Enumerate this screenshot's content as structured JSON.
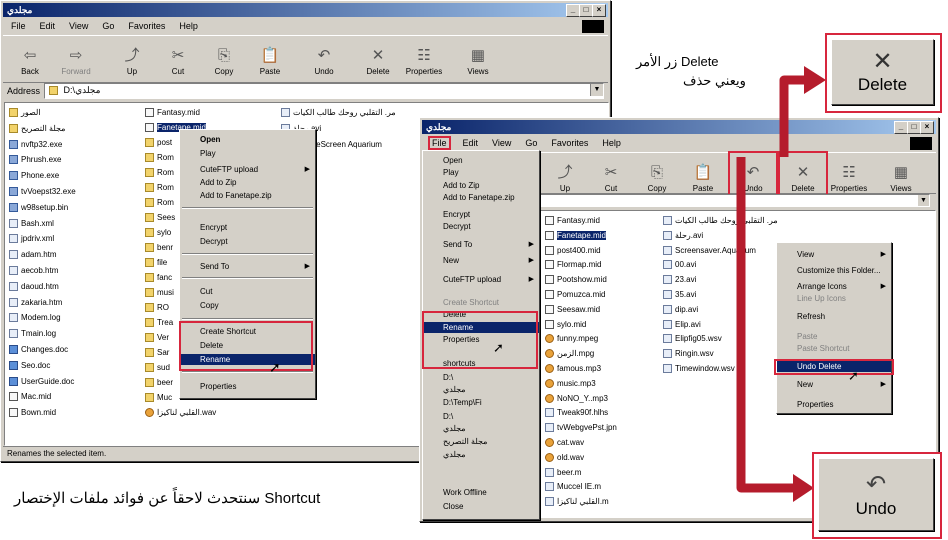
{
  "left_window": {
    "title": "مجلدي",
    "menu": [
      "File",
      "Edit",
      "View",
      "Go",
      "Favorites",
      "Help"
    ],
    "toolbar": [
      {
        "label": "Back",
        "icon": "back-arrow-icon"
      },
      {
        "label": "Forward",
        "icon": "forward-arrow-icon"
      },
      {
        "label": "Up",
        "icon": "up-folder-icon"
      },
      {
        "label": "Cut",
        "icon": "scissors-icon"
      },
      {
        "label": "Copy",
        "icon": "copy-icon"
      },
      {
        "label": "Paste",
        "icon": "paste-icon"
      },
      {
        "label": "Undo",
        "icon": "undo-icon"
      },
      {
        "label": "Delete",
        "icon": "delete-x-icon"
      },
      {
        "label": "Properties",
        "icon": "properties-icon"
      },
      {
        "label": "Views",
        "icon": "views-icon"
      }
    ],
    "address_label": "Address",
    "address_value": "D:\\مجلدي",
    "files_col1": [
      "الصور",
      "مجلة التصريح",
      "nvftp32.exe",
      "Phrush.exe",
      "Phone.exe",
      "tvVoepst32.exe",
      "w98setup.bin",
      "Bash.xml",
      "jpdriv.xml",
      "adam.htm",
      "aecob.htm",
      "daoud.htm",
      "zakaria.htm",
      "Modem.log",
      "Tmain.log",
      "Changes.doc",
      "Seo.doc",
      "UserGuide.doc",
      "Mac.mid",
      "Bown.mid"
    ],
    "files_col2": [
      "Fantasy.mid",
      "Fanetape.mid",
      "post",
      "Rom",
      "Rom",
      "Rom",
      "Rom",
      "Sees",
      "sylo",
      "benr",
      "file",
      "fanc",
      "musi",
      "RO",
      "Trea",
      "Ver",
      "Sar",
      "sud",
      "beer",
      "Muc",
      "القلبي لناكيزا.wav"
    ],
    "files_col3": [
      "مر. التقلبي روحك طالب الكيات",
      "رحلة.avi",
      "...ThreeScreen Aquarium"
    ],
    "context_menu": [
      "Open",
      "Play",
      "CuteFTP upload",
      "Add to Zip",
      "Add to Fanetape.zip",
      "Encrypt",
      "Decrypt",
      "Send To",
      "Cut",
      "Copy",
      "Create Shortcut",
      "Delete",
      "Rename",
      "Properties"
    ],
    "status": "Renames the selected item."
  },
  "right_window": {
    "title": "مجلدي",
    "menu": [
      "File",
      "Edit",
      "View",
      "Go",
      "Favorites",
      "Help"
    ],
    "toolbar": [
      {
        "label": "Up",
        "icon": "up-folder-icon"
      },
      {
        "label": "Cut",
        "icon": "scissors-icon"
      },
      {
        "label": "Copy",
        "icon": "copy-icon"
      },
      {
        "label": "Paste",
        "icon": "paste-icon"
      },
      {
        "label": "Undo",
        "icon": "undo-icon"
      },
      {
        "label": "Delete",
        "icon": "delete-x-icon"
      },
      {
        "label": "Properties",
        "icon": "properties-icon"
      },
      {
        "label": "Views",
        "icon": "views-icon"
      }
    ],
    "files_col1": [
      "Fantasy.mid",
      "Fanetape.mid",
      "post400.mid",
      "Flormap.mid",
      "Pootshow.mid",
      "Pomuzca.mid",
      "Seesaw.mid",
      "sylo.mid",
      "funny.mpeg",
      "الزمن.mpg",
      "famous.mp3",
      "music.mp3",
      "NoNO_Y..mp3",
      "Tweak90f.hlhs",
      "tvWebgvePst.jpn",
      "cat.wav",
      "old.wav",
      "beer.m",
      "Muccel IE.m",
      "القلبي لناكيزا.m"
    ],
    "files_col2": [
      "مر. التقلبي روحك طالب الكيات",
      "رحلة.avi",
      "Screensaver.Aquarium",
      "00.avi",
      "23.avi",
      "35.avi",
      "dip.avi",
      "Elip.avi",
      "Elipfig05.wsv",
      "Ringin.wsv",
      "Timewindow.wsv"
    ],
    "file_menu": [
      "Open",
      "Play",
      "Add to Zip",
      "Add to Fanetape.zip",
      "Encrypt",
      "Decrypt",
      "Send To",
      "New",
      "CuteFTP upload",
      "Create Shortcut",
      "Delete",
      "Rename",
      "Properties",
      "shortcuts",
      "D:\\",
      "مجلدي",
      "D:\\Temp\\Fi",
      "D:\\",
      "مجلدي",
      "مجلة التصريح",
      "مجلدي",
      "Work Offline",
      "Close"
    ],
    "bg_context_menu": [
      "View",
      "Customize this Folder...",
      "Arrange Icons",
      "Line Up Icons",
      "Refresh",
      "Paste",
      "Paste Shortcut",
      "Undo Delete",
      "New",
      "Properties"
    ]
  },
  "callouts": {
    "delete": {
      "label": "Delete",
      "icon": "delete-x-icon"
    },
    "undo": {
      "label": "Undo",
      "icon": "undo-icon"
    }
  },
  "captions": {
    "delete_line1": "زر الأمر Delete",
    "delete_line2": "ويعني حذف",
    "shortcut_note": "سنتحدث لاحقاً عن فوائد ملفات الإختصار Shortcut"
  },
  "colors": {
    "titlebar": "#0a246a",
    "highlight_red": "#d7263d",
    "menu_highlight": "#0a246a",
    "window_face": "#d4d0c8"
  }
}
